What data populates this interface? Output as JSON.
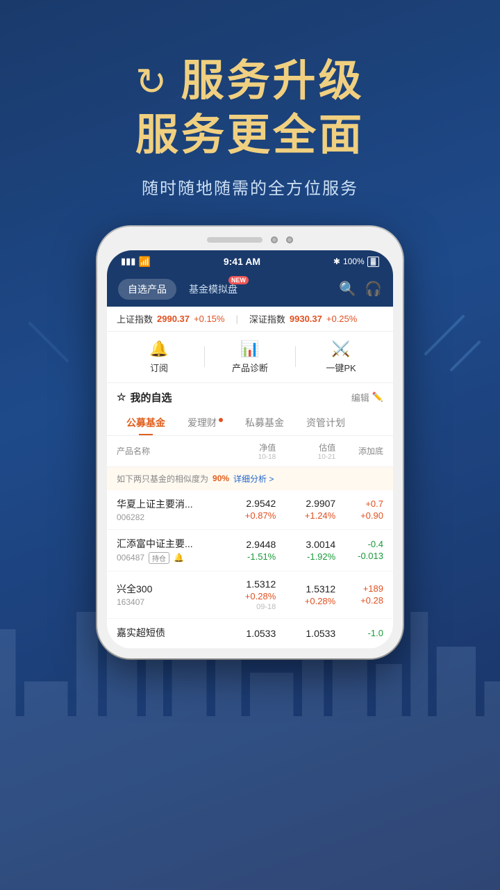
{
  "hero": {
    "icon": "↺",
    "title_line1": "服务升级",
    "title_line2": "服务更全面",
    "subtitle": "随时随地随需的全方位服务"
  },
  "deco": {
    "lines": "decorative"
  },
  "phone": {
    "status": {
      "signal": "▮▮▮",
      "wifi": "wifi",
      "time": "9:41 AM",
      "bluetooth": "✱",
      "battery": "100%"
    },
    "tabs": [
      {
        "label": "自选产品",
        "active": true,
        "new_badge": ""
      },
      {
        "label": "基金模拟盘",
        "active": false,
        "new_badge": "NEW"
      }
    ],
    "ticker": {
      "sh_label": "上证指数",
      "sh_value": "2990.37",
      "sh_change": "+0.15%",
      "sz_label": "深证指数",
      "sz_value": "9930.37",
      "sz_change": "+0.25%"
    },
    "actions": [
      {
        "label": "订阅",
        "icon": "🔔"
      },
      {
        "label": "产品诊断",
        "icon": "📊"
      },
      {
        "label": "一键PK",
        "icon": "⚡"
      }
    ],
    "section": {
      "title": "我的自选",
      "edit_label": "编辑"
    },
    "categories": [
      {
        "label": "公募基金",
        "active": true,
        "dot": false
      },
      {
        "label": "爱理财",
        "active": false,
        "dot": true
      },
      {
        "label": "私募基金",
        "active": false,
        "dot": false
      },
      {
        "label": "资管计划",
        "active": false,
        "dot": false
      }
    ],
    "table_header": {
      "name": "产品名称",
      "nav": "净值",
      "nav_date": "10-18",
      "est": "估值",
      "est_date": "10-21",
      "add": "添加底\n添加底"
    },
    "similarity": {
      "text_before": "如下两只基金的相似度为",
      "pct": "90%",
      "link": "详细分析 >"
    },
    "funds": [
      {
        "name": "华夏上证主要消...",
        "code": "006282",
        "tag": "",
        "bell": false,
        "nav": "2.9542",
        "nav_chg": "+0.87%",
        "est": "2.9907",
        "est_chg": "+1.24%",
        "add_main": "+0.7",
        "add_sub": "+0.90"
      },
      {
        "name": "汇添富中证主要...",
        "code": "006487",
        "tag": "持仓",
        "bell": true,
        "nav": "2.9448",
        "nav_chg": "-1.51%",
        "est": "3.0014",
        "est_chg": "-1.92%",
        "add_main": "-0.4",
        "add_sub": "-0.013"
      },
      {
        "name": "兴全300",
        "code": "163407",
        "tag": "",
        "bell": false,
        "nav": "1.5312",
        "nav_chg": "+0.28%",
        "est": "1.5312",
        "est_chg": "+0.28%",
        "add_main": "+189",
        "add_sub": "+0.28",
        "date": "09-18"
      },
      {
        "name": "嘉实超短债",
        "code": "",
        "tag": "",
        "bell": false,
        "nav": "1.0533",
        "nav_chg": "",
        "est": "1.0533",
        "est_chg": "",
        "add_main": "-1.0",
        "add_sub": ""
      }
    ]
  }
}
